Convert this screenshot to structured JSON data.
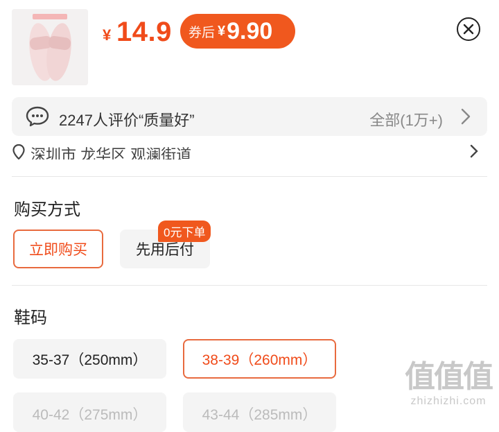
{
  "header": {
    "price_symbol": "¥",
    "price": "14.9",
    "coupon_label": "券后",
    "coupon_symbol": "¥",
    "coupon_price": "9.90"
  },
  "review": {
    "text": "2247人评价“质量好”",
    "all_label": "全部(1万+)"
  },
  "address": {
    "text": "深圳市 龙华区 观澜街道"
  },
  "purchase": {
    "title": "购买方式",
    "options": [
      {
        "label": "立即购买",
        "state": "selected"
      },
      {
        "label": "先用后付",
        "state": "normal",
        "badge": "0元下单"
      }
    ]
  },
  "size": {
    "title": "鞋码",
    "options": [
      {
        "label": "35-37（250mm）",
        "state": "normal"
      },
      {
        "label": "38-39（260mm）",
        "state": "selected"
      },
      {
        "label": "40-42（275mm）",
        "state": "faded"
      },
      {
        "label": "43-44（285mm）",
        "state": "faded"
      }
    ]
  },
  "watermark": {
    "big": "值值值",
    "small": "zhizhizhi.com"
  },
  "colors": {
    "accent": "#f04b1a",
    "coupon_bg": "#f0581e",
    "chip_bg": "#f4f4f4"
  }
}
